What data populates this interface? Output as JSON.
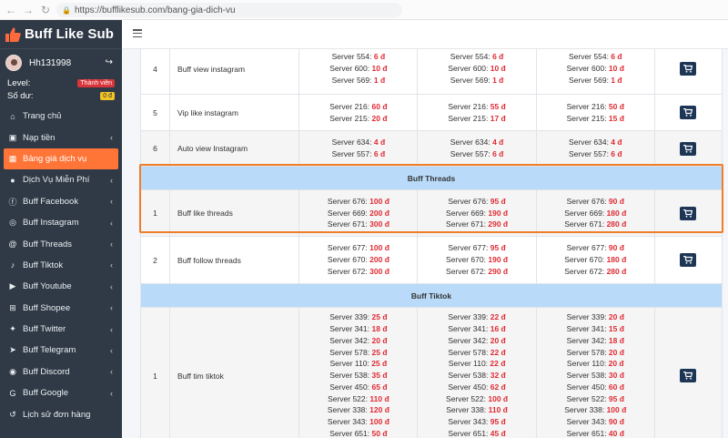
{
  "browser": {
    "url": "https://bufflikesub.com/bang-gia-dich-vu"
  },
  "brand": {
    "name": "Buff Like Sub"
  },
  "user": {
    "name": "Hh131998",
    "level_label": "Level:",
    "level_badge": "Thành viên",
    "balance_label": "Số dư:",
    "balance_value": "0 đ"
  },
  "menu": [
    {
      "label": "Trang chủ",
      "icon": "dashboard-icon",
      "chevron": false,
      "active": false
    },
    {
      "label": "Nạp tiền",
      "icon": "wallet-icon",
      "chevron": true,
      "active": false
    },
    {
      "label": "Bảng giá dịch vụ",
      "icon": "table-icon",
      "chevron": false,
      "active": true
    },
    {
      "label": "Dịch Vụ Miễn Phí",
      "icon": "free-icon",
      "chevron": true,
      "active": false
    },
    {
      "label": "Buff Facebook",
      "icon": "facebook-icon",
      "chevron": true,
      "active": false
    },
    {
      "label": "Buff Instagram",
      "icon": "instagram-icon",
      "chevron": true,
      "active": false
    },
    {
      "label": "Buff Threads",
      "icon": "threads-icon",
      "chevron": true,
      "active": false
    },
    {
      "label": "Buff Tiktok",
      "icon": "tiktok-icon",
      "chevron": true,
      "active": false
    },
    {
      "label": "Buff Youtube",
      "icon": "youtube-icon",
      "chevron": true,
      "active": false
    },
    {
      "label": "Buff Shopee",
      "icon": "shopee-icon",
      "chevron": true,
      "active": false
    },
    {
      "label": "Buff Twitter",
      "icon": "twitter-icon",
      "chevron": true,
      "active": false
    },
    {
      "label": "Buff Telegram",
      "icon": "telegram-icon",
      "chevron": true,
      "active": false
    },
    {
      "label": "Buff Discord",
      "icon": "discord-icon",
      "chevron": true,
      "active": false
    },
    {
      "label": "Buff Google",
      "icon": "google-icon",
      "chevron": true,
      "active": false
    },
    {
      "label": "Lịch sử đơn hàng",
      "icon": "history-icon",
      "chevron": false,
      "active": false
    }
  ],
  "colors": {
    "accent": "#ff7437",
    "sidebar": "#2f3a46",
    "price": "#e02b33",
    "section": "#b9dbf9",
    "highlight": "#f07d2a",
    "cart": "#1d3656"
  },
  "rows": [
    {
      "type": "row",
      "index": "4",
      "name": "Buff view instagram",
      "alt": false,
      "cols": [
        [
          [
            "Server 554",
            "6 đ"
          ],
          [
            "Server 600",
            "10 đ"
          ],
          [
            "Server 569",
            "1 đ"
          ]
        ],
        [
          [
            "Server 554",
            "6 đ"
          ],
          [
            "Server 600",
            "10 đ"
          ],
          [
            "Server 569",
            "1 đ"
          ]
        ],
        [
          [
            "Server 554",
            "6 đ"
          ],
          [
            "Server 600",
            "10 đ"
          ],
          [
            "Server 569",
            "1 đ"
          ]
        ]
      ]
    },
    {
      "type": "row",
      "index": "5",
      "name": "Vip like instagram",
      "alt": false,
      "cols": [
        [
          [
            "Server 216",
            "60 đ"
          ],
          [
            "Server 215",
            "20 đ"
          ]
        ],
        [
          [
            "Server 216",
            "55 đ"
          ],
          [
            "Server 215",
            "17 đ"
          ]
        ],
        [
          [
            "Server 216",
            "50 đ"
          ],
          [
            "Server 215",
            "15 đ"
          ]
        ]
      ]
    },
    {
      "type": "row",
      "index": "6",
      "name": "Auto view Instagram",
      "alt": true,
      "cols": [
        [
          [
            "Server 634",
            "4 đ"
          ],
          [
            "Server 557",
            "6 đ"
          ]
        ],
        [
          [
            "Server 634",
            "4 đ"
          ],
          [
            "Server 557",
            "6 đ"
          ]
        ],
        [
          [
            "Server 634",
            "4 đ"
          ],
          [
            "Server 557",
            "6 đ"
          ]
        ]
      ]
    },
    {
      "type": "section",
      "title": "Buff Threads"
    },
    {
      "type": "row",
      "index": "1",
      "name": "Buff like threads",
      "alt": true,
      "cols": [
        [
          [
            "Server 676",
            "100 đ"
          ],
          [
            "Server 669",
            "200 đ"
          ],
          [
            "Server 671",
            "300 đ"
          ]
        ],
        [
          [
            "Server 676",
            "95 đ"
          ],
          [
            "Server 669",
            "190 đ"
          ],
          [
            "Server 671",
            "290 đ"
          ]
        ],
        [
          [
            "Server 676",
            "90 đ"
          ],
          [
            "Server 669",
            "180 đ"
          ],
          [
            "Server 671",
            "280 đ"
          ]
        ]
      ]
    },
    {
      "type": "row",
      "index": "2",
      "name": "Buff follow threads",
      "alt": false,
      "cols": [
        [
          [
            "Server 677",
            "100 đ"
          ],
          [
            "Server 670",
            "200 đ"
          ],
          [
            "Server 672",
            "300 đ"
          ]
        ],
        [
          [
            "Server 677",
            "95 đ"
          ],
          [
            "Server 670",
            "190 đ"
          ],
          [
            "Server 672",
            "290 đ"
          ]
        ],
        [
          [
            "Server 677",
            "90 đ"
          ],
          [
            "Server 670",
            "180 đ"
          ],
          [
            "Server 672",
            "280 đ"
          ]
        ]
      ]
    },
    {
      "type": "section",
      "title": "Buff Tiktok"
    },
    {
      "type": "row",
      "index": "1",
      "name": "Buff tim tiktok",
      "alt": true,
      "cols": [
        [
          [
            "Server 339",
            "25 đ"
          ],
          [
            "Server 341",
            "18 đ"
          ],
          [
            "Server 342",
            "20 đ"
          ],
          [
            "Server 578",
            "25 đ"
          ],
          [
            "Server 110",
            "25 đ"
          ],
          [
            "Server 538",
            "35 đ"
          ],
          [
            "Server 450",
            "65 đ"
          ],
          [
            "Server 522",
            "110 đ"
          ],
          [
            "Server 338",
            "120 đ"
          ],
          [
            "Server 343",
            "100 đ"
          ],
          [
            "Server 651",
            "50 đ"
          ]
        ],
        [
          [
            "Server 339",
            "22 đ"
          ],
          [
            "Server 341",
            "16 đ"
          ],
          [
            "Server 342",
            "20 đ"
          ],
          [
            "Server 578",
            "22 đ"
          ],
          [
            "Server 110",
            "22 đ"
          ],
          [
            "Server 538",
            "32 đ"
          ],
          [
            "Server 450",
            "62 đ"
          ],
          [
            "Server 522",
            "100 đ"
          ],
          [
            "Server 338",
            "110 đ"
          ],
          [
            "Server 343",
            "95 đ"
          ],
          [
            "Server 651",
            "45 đ"
          ]
        ],
        [
          [
            "Server 339",
            "20 đ"
          ],
          [
            "Server 341",
            "15 đ"
          ],
          [
            "Server 342",
            "18 đ"
          ],
          [
            "Server 578",
            "20 đ"
          ],
          [
            "Server 110",
            "20 đ"
          ],
          [
            "Server 538",
            "30 đ"
          ],
          [
            "Server 450",
            "60 đ"
          ],
          [
            "Server 522",
            "95 đ"
          ],
          [
            "Server 338",
            "100 đ"
          ],
          [
            "Server 343",
            "90 đ"
          ],
          [
            "Server 651",
            "40 đ"
          ]
        ]
      ]
    }
  ]
}
